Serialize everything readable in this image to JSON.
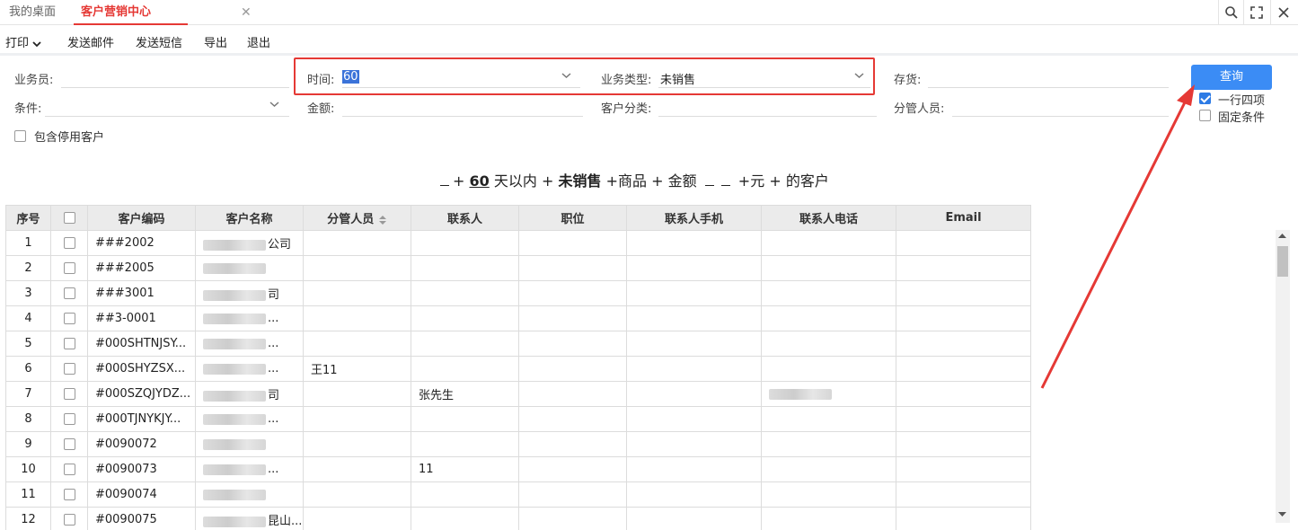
{
  "tabs": {
    "home": "我的桌面",
    "active": "客户营销中心",
    "close": "✕"
  },
  "window": {
    "search_icon": "⚲",
    "maximize_icon": "⛶",
    "close_icon": "✕"
  },
  "toolbar": {
    "print": "打印",
    "send_email": "发送邮件",
    "send_sms": "发送短信",
    "export": "导出",
    "exit": "退出"
  },
  "filters": {
    "salesperson_label": "业务员:",
    "time_label": "时间:",
    "time_value": "60",
    "biz_type_label": "业务类型:",
    "biz_type_value": "未销售",
    "stock_label": "存货:",
    "condition_label": "条件:",
    "amount_label": "金额:",
    "category_label": "客户分类:",
    "manager_label": "分管人员:",
    "include_disabled": "包含停用客户",
    "one_row_four": "一行四项",
    "fixed_condition": "固定条件",
    "query_button": "查询"
  },
  "summary": {
    "p1": "+",
    "days": "60",
    "p2": "天以内",
    "p3": "+",
    "type": "未销售",
    "p4": "+商品",
    "p5": "+",
    "amount": "金额",
    "p6": "+",
    "p7": "元",
    "p8": "+",
    "p9": "的客户"
  },
  "table": {
    "headers": [
      "序号",
      "",
      "客户编码",
      "客户名称",
      "分管人员",
      "联系人",
      "职位",
      "联系人手机",
      "联系人电话",
      "Email"
    ],
    "rows": [
      {
        "no": "1",
        "code": "###2002",
        "name": "公司",
        "mgr": "",
        "contact": ""
      },
      {
        "no": "2",
        "code": "###2005",
        "name": "",
        "mgr": "",
        "contact": ""
      },
      {
        "no": "3",
        "code": "###3001",
        "name": "司",
        "mgr": "",
        "contact": ""
      },
      {
        "no": "4",
        "code": "##3-0001",
        "name": "...",
        "mgr": "",
        "contact": ""
      },
      {
        "no": "5",
        "code": "#000SHTNJSY...",
        "name": "...",
        "mgr": "",
        "contact": ""
      },
      {
        "no": "6",
        "code": "#000SHYZSX...",
        "name": "...",
        "mgr": "王11",
        "contact": ""
      },
      {
        "no": "7",
        "code": "#000SZQJYDZ...",
        "name": "司",
        "mgr": "",
        "contact": "张先生"
      },
      {
        "no": "8",
        "code": "#000TJNYKJY...",
        "name": "...",
        "mgr": "",
        "contact": ""
      },
      {
        "no": "9",
        "code": "#0090072",
        "name": "",
        "mgr": "",
        "contact": ""
      },
      {
        "no": "10",
        "code": "#0090073",
        "name": "...",
        "mgr": "",
        "contact": "11"
      },
      {
        "no": "11",
        "code": "#0090074",
        "name": "",
        "mgr": "",
        "contact": ""
      },
      {
        "no": "12",
        "code": "#0090075",
        "name": "昆山...",
        "mgr": "",
        "contact": ""
      }
    ]
  },
  "colors": {
    "accent_red": "#e53935",
    "query_blue": "#3b8cf5",
    "header_bg": "#ebebeb"
  }
}
